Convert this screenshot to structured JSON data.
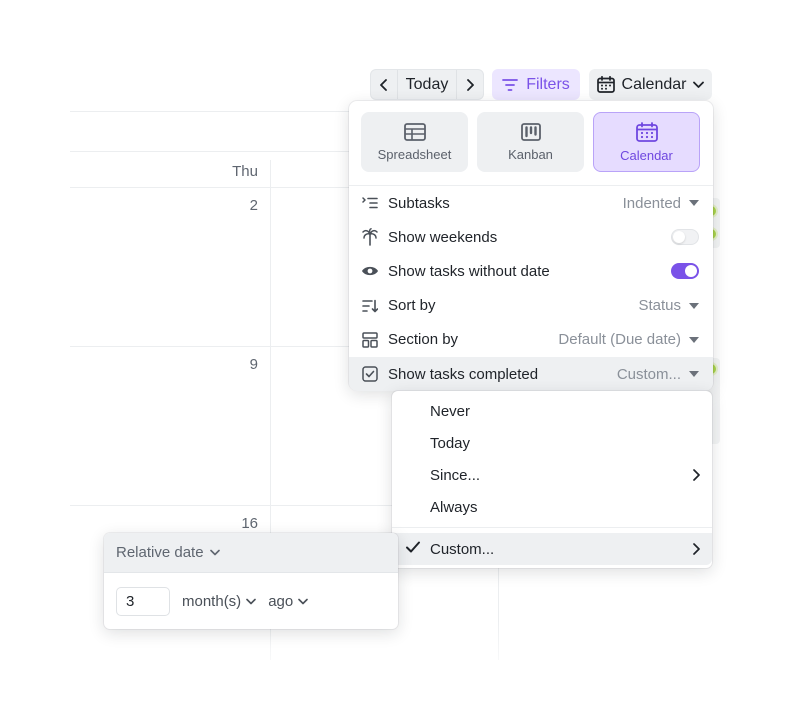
{
  "calendar": {
    "day_header": "Thu",
    "day_numbers": [
      "2",
      "9",
      "16"
    ]
  },
  "toolbar": {
    "prev_icon": "chevron-left-icon",
    "today_label": "Today",
    "next_icon": "chevron-right-icon",
    "filters_label": "Filters",
    "filters_icon": "filter-icon",
    "view_label": "Calendar",
    "view_icon": "calendar-icon"
  },
  "view_switcher": {
    "options": [
      {
        "label": "Spreadsheet",
        "icon": "table-icon",
        "active": false
      },
      {
        "label": "Kanban",
        "icon": "kanban-icon",
        "active": false
      },
      {
        "label": "Calendar",
        "icon": "calendar-icon",
        "active": true
      }
    ]
  },
  "settings": {
    "rows": [
      {
        "label": "Subtasks",
        "value": "Indented",
        "icon": "subtasks-icon"
      },
      {
        "label": "Show weekends",
        "toggle": false,
        "icon": "palm-tree-icon"
      },
      {
        "label": "Show tasks without date",
        "toggle": true,
        "icon": "eye-icon"
      },
      {
        "label": "Sort by",
        "value": "Status",
        "icon": "sort-icon"
      },
      {
        "label": "Section by",
        "value": "Default (Due date)",
        "icon": "layout-icon"
      },
      {
        "label": "Show tasks completed",
        "value": "Custom...",
        "icon": "checkbox-icon"
      }
    ]
  },
  "completed_menu": {
    "items": [
      {
        "label": "Never"
      },
      {
        "label": "Today"
      },
      {
        "label": "Since...",
        "has_submenu": true
      },
      {
        "label": "Always"
      },
      {
        "label": "Custom...",
        "has_submenu": true,
        "selected": true
      }
    ]
  },
  "relative_date": {
    "mode_label": "Relative date",
    "amount": "3",
    "unit": "month(s)",
    "direction": "ago"
  },
  "colors": {
    "accent": "#7a52e8",
    "accent_bg": "#ece6ff",
    "status_green": "#a9d44a"
  }
}
